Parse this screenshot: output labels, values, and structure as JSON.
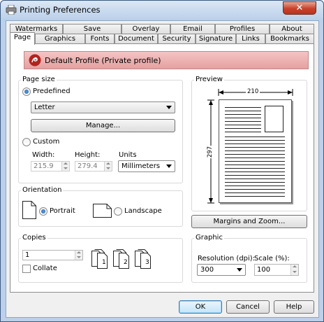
{
  "window": {
    "title": "Printing Preferences",
    "close": "✕"
  },
  "tabs_back": [
    "Watermarks",
    "Save",
    "Overlay",
    "Email",
    "Profiles",
    "About"
  ],
  "tabs_front": [
    "Page",
    "Graphics",
    "Fonts",
    "Document",
    "Security",
    "Signature",
    "Links",
    "Bookmarks"
  ],
  "active_tab": "Page",
  "profile": {
    "label": "Default Profile (Private profile)"
  },
  "page_size": {
    "group_title": "Page size",
    "predefined_label": "Predefined",
    "predefined_selected": true,
    "paper_value": "Letter",
    "manage_button": "Manage...",
    "custom_label": "Custom",
    "width_label": "Width:",
    "width_value": "215.9",
    "height_label": "Height:",
    "height_value": "279.4",
    "units_label": "Units",
    "units_value": "Millimeters"
  },
  "orientation": {
    "group_title": "Orientation",
    "portrait_label": "Portrait",
    "landscape_label": "Landscape",
    "selected": "Portrait"
  },
  "copies": {
    "group_title": "Copies",
    "value": "1",
    "collate_label": "Collate",
    "collate_checked": false,
    "collate_pages": [
      "1",
      "2",
      "3"
    ]
  },
  "preview": {
    "group_title": "Preview",
    "width_dim": "210",
    "height_dim": "297",
    "margins_button": "Margins and Zoom..."
  },
  "graphic": {
    "group_title": "Graphic",
    "resolution_label": "Resolution (dpi):",
    "resolution_value": "300",
    "scale_label": "Scale (%):",
    "scale_value": "100"
  },
  "footer": {
    "ok": "OK",
    "cancel": "Cancel",
    "help": "Help"
  },
  "colors": {
    "accent": "#c8402a",
    "profile_bg": "#e6a0a0",
    "frame": "#bcd0e9"
  }
}
